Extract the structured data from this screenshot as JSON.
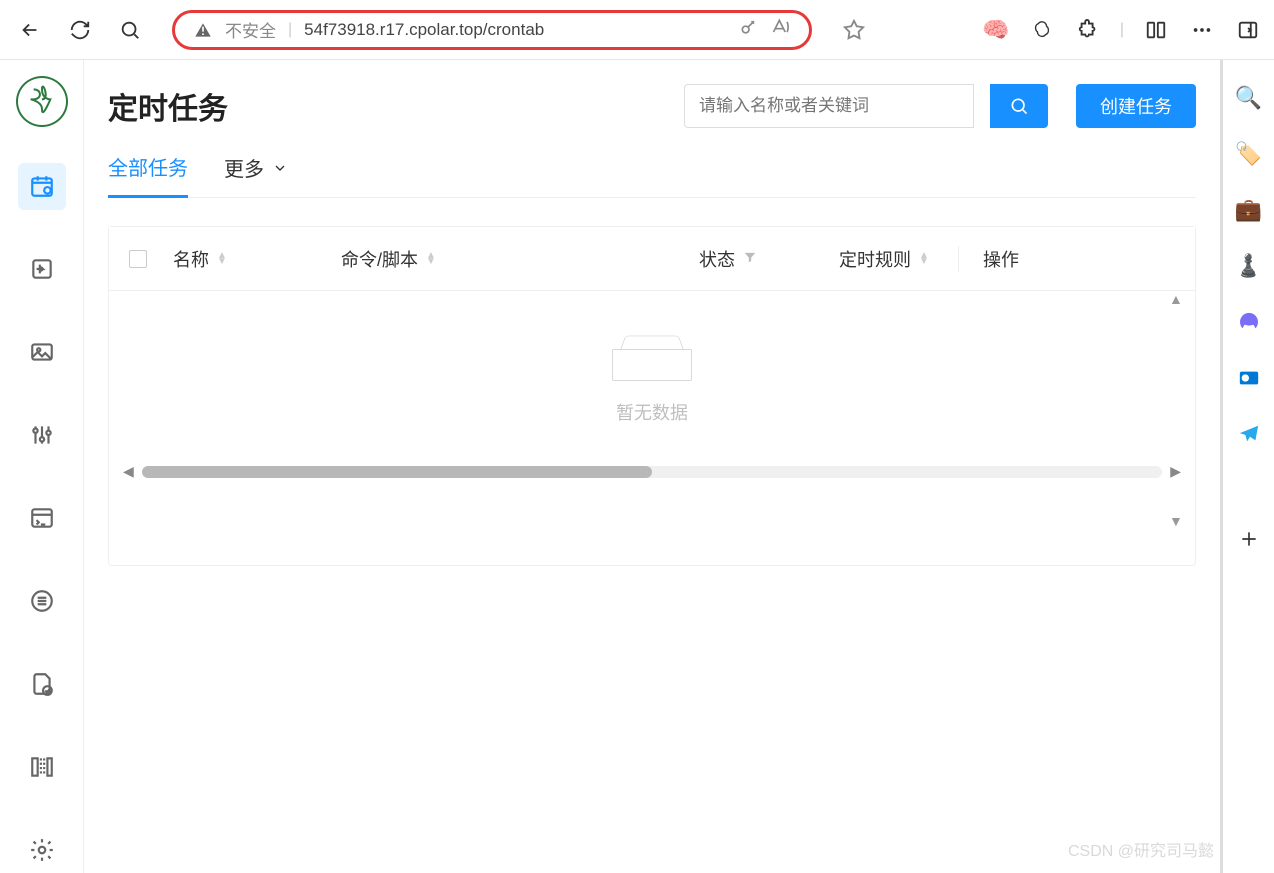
{
  "browser": {
    "insecure_label": "不安全",
    "url": "54f73918.r17.cpolar.top/crontab"
  },
  "page": {
    "title": "定时任务",
    "search_placeholder": "请输入名称或者关键词",
    "create_label": "创建任务"
  },
  "tabs": {
    "all": "全部任务",
    "more": "更多"
  },
  "table": {
    "cols": {
      "name": "名称",
      "cmd": "命令/脚本",
      "status": "状态",
      "rule": "定时规则",
      "action": "操作"
    },
    "empty": "暂无数据"
  },
  "watermark": "CSDN @研究司马懿"
}
